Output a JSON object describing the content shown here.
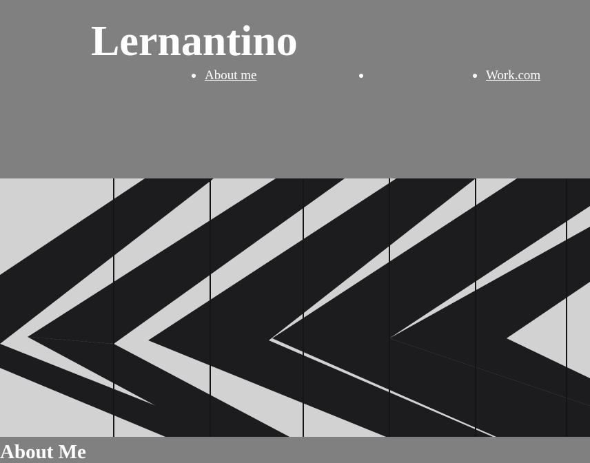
{
  "site": {
    "title": "Lernantino"
  },
  "nav": {
    "items": [
      {
        "label": "About me"
      },
      {
        "label": ""
      },
      {
        "label": "Work.com"
      }
    ]
  },
  "hero": {
    "image_description_icon": "striped-wood-wall-image"
  },
  "sections": {
    "about_heading": "About Me"
  },
  "colors": {
    "page_background": "#808080",
    "text": "#ffffff",
    "stripe_dark": "#1c1c1e",
    "stripe_light": "#d2d2d2"
  }
}
